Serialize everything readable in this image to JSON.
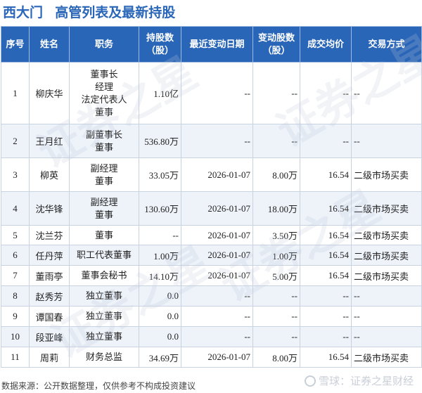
{
  "title": {
    "company": "西大门",
    "subtitle": "高管列表及最新持股"
  },
  "table": {
    "headers": [
      "序号",
      "姓名",
      "职务",
      "持股数\n（股）",
      "最近变动日期",
      "变动股数\n（股）",
      "成交均价",
      "交易方式"
    ],
    "rows": [
      {
        "idx": "1",
        "name": "柳庆华",
        "positions": [
          "董事长",
          "经理",
          "法定代表人",
          "董事"
        ],
        "shares": "1.10亿",
        "date": "--",
        "change": "--",
        "change_red": false,
        "price": "--",
        "price_red": false,
        "method": "--"
      },
      {
        "idx": "2",
        "name": "王月红",
        "positions": [
          "副董事长",
          "董事"
        ],
        "shares": "536.80万",
        "date": "--",
        "change": "--",
        "change_red": false,
        "price": "--",
        "price_red": false,
        "method": "--"
      },
      {
        "idx": "3",
        "name": "柳英",
        "positions": [
          "副经理",
          "董事"
        ],
        "shares": "33.05万",
        "date": "2026-01-07",
        "change": "8.00万",
        "change_red": true,
        "price": "16.54",
        "price_red": true,
        "method": "二级市场买卖"
      },
      {
        "idx": "4",
        "name": "沈华锋",
        "positions": [
          "副经理",
          "董事"
        ],
        "shares": "130.60万",
        "date": "2026-01-07",
        "change": "18.00万",
        "change_red": true,
        "price": "16.54",
        "price_red": true,
        "method": "二级市场买卖"
      },
      {
        "idx": "5",
        "name": "沈兰芬",
        "positions": [
          "董事"
        ],
        "shares": "--",
        "date": "2026-01-07",
        "change": "3.50万",
        "change_red": true,
        "price": "16.54",
        "price_red": true,
        "method": "二级市场买卖"
      },
      {
        "idx": "6",
        "name": "任丹萍",
        "positions": [
          "职工代表董事"
        ],
        "shares": "1.00万",
        "date": "2026-01-07",
        "change": "1.00万",
        "change_red": true,
        "price": "16.54",
        "price_red": true,
        "method": "二级市场买卖"
      },
      {
        "idx": "7",
        "name": "董雨亭",
        "positions": [
          "董事会秘书"
        ],
        "shares": "14.10万",
        "date": "2026-01-07",
        "change": "5.00万",
        "change_red": true,
        "price": "16.54",
        "price_red": true,
        "method": "二级市场买卖"
      },
      {
        "idx": "8",
        "name": "赵秀芳",
        "positions": [
          "独立董事"
        ],
        "shares": "0.0",
        "date": "--",
        "change": "--",
        "change_red": false,
        "price": "--",
        "price_red": false,
        "method": "--"
      },
      {
        "idx": "9",
        "name": "谭国春",
        "positions": [
          "独立董事"
        ],
        "shares": "0.0",
        "date": "--",
        "change": "--",
        "change_red": false,
        "price": "--",
        "price_red": false,
        "method": "--"
      },
      {
        "idx": "10",
        "name": "段亚峰",
        "positions": [
          "独立董事"
        ],
        "shares": "0.0",
        "date": "--",
        "change": "--",
        "change_red": false,
        "price": "--",
        "price_red": false,
        "method": "--"
      },
      {
        "idx": "11",
        "name": "周莉",
        "positions": [
          "财务总监"
        ],
        "shares": "34.69万",
        "date": "2026-01-07",
        "change": "8.00万",
        "change_red": true,
        "price": "16.54",
        "price_red": true,
        "method": "二级市场买卖"
      }
    ]
  },
  "footer": "数据来源：公开数据整理，仅供参考不构成投资建议",
  "watermark": "证券之星",
  "brand": "雪球：证券之星财经",
  "colors": {
    "header_bg": "#2a66b8",
    "title": "#2a66b8",
    "highlight_red": "#e02020",
    "row_alt": "#eef3fa"
  }
}
